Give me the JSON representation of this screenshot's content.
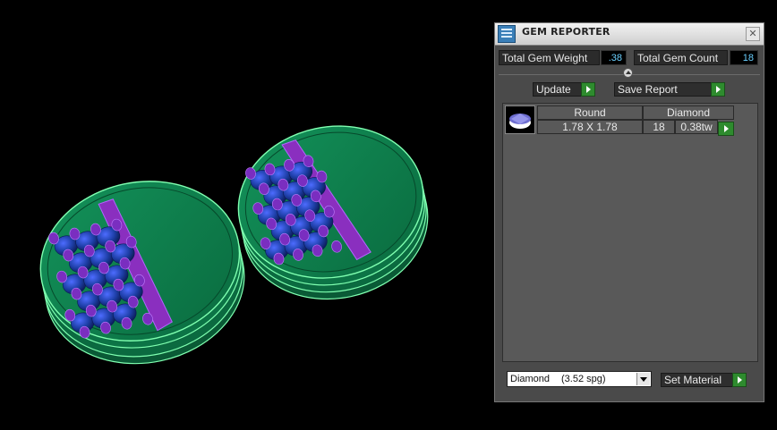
{
  "panel": {
    "title": "GEM REPORTER",
    "close_label": "✕",
    "total_weight_label": "Total Gem Weight",
    "total_weight_value": ".38",
    "total_count_label": "Total Gem Count",
    "total_count_value": "18",
    "update_label": "Update",
    "save_report_label": "Save Report",
    "set_material_label": "Set Material"
  },
  "gem_list": {
    "header_shape": "Round",
    "header_material": "Diamond",
    "size": "1.78 X 1.78",
    "count": "18",
    "weight": "0.38tw"
  },
  "material_select": {
    "name": "Diamond",
    "spg": "(3.52 spg)"
  },
  "colors": {
    "metal": "#0c7a4a",
    "bar": "#8a2fbf",
    "stone": "#1e3fa8",
    "prong": "#7a2ec0",
    "accent_go": "#2e8b2e"
  }
}
